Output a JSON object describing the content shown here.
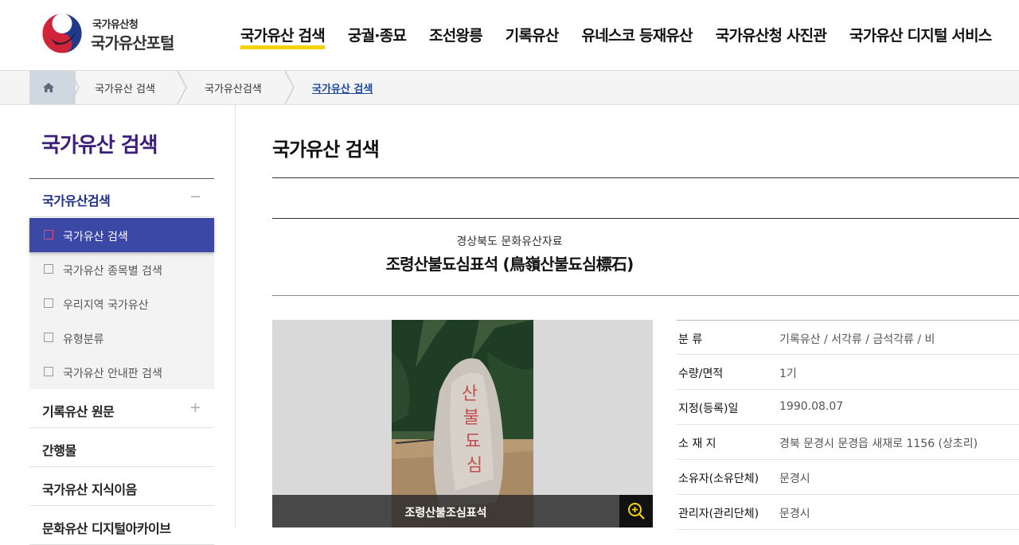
{
  "header": {
    "logo_sub": "국가유산청",
    "logo_main": "국가유산포털",
    "nav": [
      "국가유산 검색",
      "궁궐·종묘",
      "조선왕릉",
      "기록유산",
      "유네스코 등재유산",
      "국가유산청 사진관",
      "국가유산 디지털 서비스"
    ],
    "active_nav_index": 0
  },
  "breadcrumb": {
    "home_icon": "home-icon",
    "items": [
      "국가유산 검색",
      "국가유산검색",
      "국가유산 검색"
    ]
  },
  "lnb": {
    "title": "국가유산 검색",
    "groups": [
      {
        "label": "국가유산검색",
        "toggle": "−"
      },
      {
        "label": "기록유산 원문",
        "toggle": "+"
      },
      {
        "label": "간행물",
        "toggle": ""
      },
      {
        "label": "국가유산 지식이음",
        "toggle": ""
      },
      {
        "label": "문화유산 디지털아카이브",
        "toggle": ""
      }
    ],
    "sub_items": [
      "국가유산 검색",
      "국가유산 종목별 검색",
      "우리지역 국가유산",
      "유형분류",
      "국가유산 안내판 검색"
    ],
    "active_sub_index": 0
  },
  "content": {
    "page_title": "국가유산 검색",
    "item_type": "경상북도 문화유산자료",
    "item_name": "조령산불됴심표석 (鳥嶺산불됴심標石)",
    "photo_caption": "조령산불조심표석",
    "info": [
      {
        "key": "분 류",
        "value": "기록유산 / 서각류 / 금석각류 / 비"
      },
      {
        "key": "수량/면적",
        "value": "1기"
      },
      {
        "key": "지정(등록)일",
        "value": "1990.08.07"
      },
      {
        "key": "소 재 지",
        "value": "경북 문경시 문경읍 새재로 1156 (상초리)"
      },
      {
        "key": "소유자(소유단체)",
        "value": "문경시"
      },
      {
        "key": "관리자(관리단체)",
        "value": "문경시"
      }
    ]
  },
  "colors": {
    "accent_yellow": "#f4d400",
    "lnb_title": "#3b1d7a",
    "active_menu": "#3b48a6",
    "breadcrumb_current": "#1c4aa0"
  }
}
